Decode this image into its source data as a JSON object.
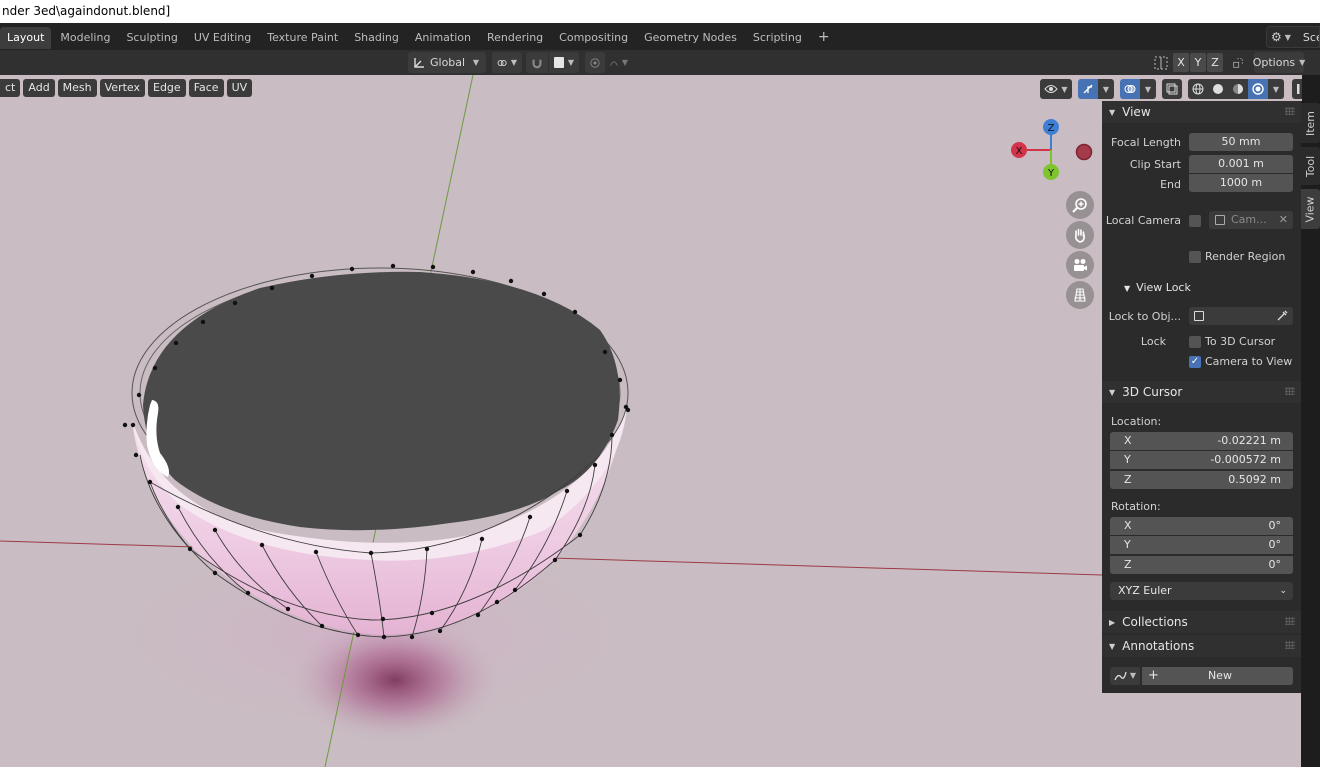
{
  "window": {
    "title": "nder 3ed\\againdonut.blend]"
  },
  "workspace_tabs": [
    "Layout",
    "Modeling",
    "Sculpting",
    "UV Editing",
    "Texture Paint",
    "Shading",
    "Animation",
    "Rendering",
    "Compositing",
    "Geometry Nodes",
    "Scripting"
  ],
  "active_tab": "Layout",
  "scene_label": "Sce",
  "header": {
    "orientation": "Global",
    "axes": [
      "X",
      "Y",
      "Z"
    ],
    "options_label": "Options"
  },
  "edit_menu": [
    "ct",
    "Add",
    "Mesh",
    "Vertex",
    "Edge",
    "Face",
    "UV"
  ],
  "gizmo": {
    "z": "Z",
    "x": "X",
    "y": "Y"
  },
  "view_panel": {
    "title": "View",
    "focal_length_label": "Focal Length",
    "focal_length": "50 mm",
    "clip_start_label": "Clip Start",
    "clip_start": "0.001 m",
    "clip_end_label": "End",
    "clip_end": "1000 m",
    "local_camera_label": "Local Camera",
    "local_camera_value": "Cam...",
    "render_region_label": "Render Region",
    "view_lock_title": "View Lock",
    "lock_to_obj_label": "Lock to Obj...",
    "lock_label": "Lock",
    "to_3d_cursor_label": "To 3D Cursor",
    "camera_to_view_label": "Camera to View"
  },
  "cursor_panel": {
    "title": "3D Cursor",
    "location_label": "Location:",
    "location": [
      {
        "axis": "X",
        "value": "-0.02221 m"
      },
      {
        "axis": "Y",
        "value": "-0.000572 m"
      },
      {
        "axis": "Z",
        "value": "0.5092 m"
      }
    ],
    "rotation_label": "Rotation:",
    "rotation": [
      {
        "axis": "X",
        "value": "0°"
      },
      {
        "axis": "Y",
        "value": "0°"
      },
      {
        "axis": "Z",
        "value": "0°"
      }
    ],
    "rotation_mode": "XYZ Euler"
  },
  "collections_title": "Collections",
  "annotations_title": "Annotations",
  "annotations_new_label": "New",
  "side_tabs": [
    "Item",
    "Tool",
    "View"
  ],
  "active_side_tab": "View",
  "colors": {
    "accent": "#4772b3",
    "viewport_bg": "#c9bcc3",
    "axis_x": "#d2344a",
    "axis_y": "#7ec42c",
    "axis_z": "#3e7fd6"
  }
}
